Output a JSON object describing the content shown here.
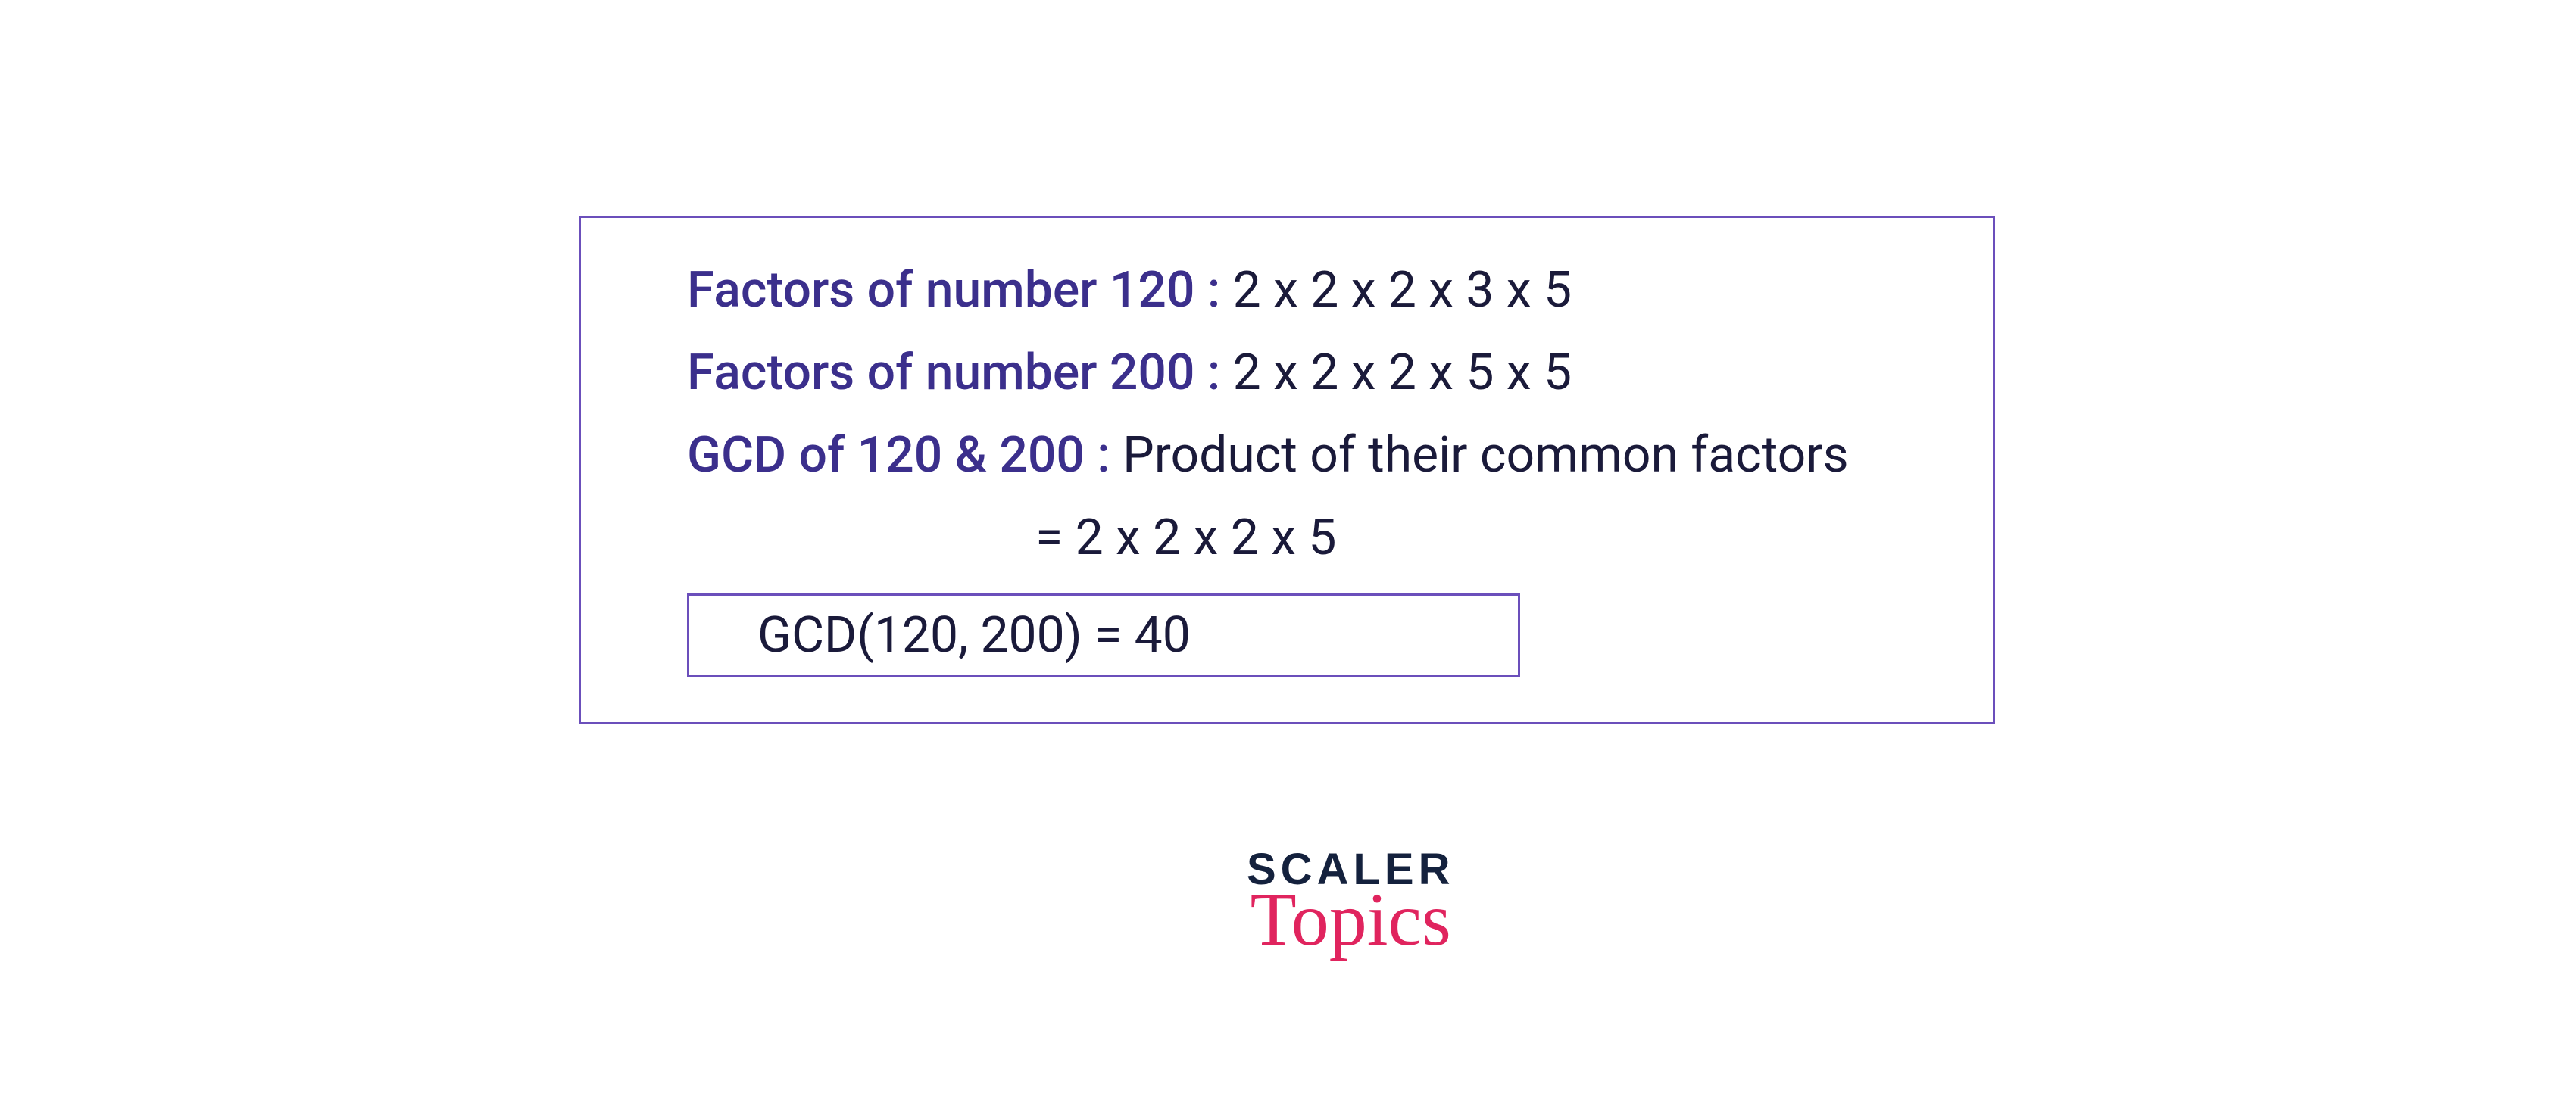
{
  "content": {
    "line1_label": "Factors of number 120 : ",
    "line1_value": "2 x 2 x 2 x 3 x 5",
    "line2_label": "Factors of number 200 : ",
    "line2_value": "2 x 2 x 2 x 5 x 5",
    "line3_label": "GCD of 120 & 200 : ",
    "line3_value": "Product of their common factors",
    "line4_value": "= 2 x 2 x 2 x 5",
    "result": "GCD(120, 200) = 40"
  },
  "logo": {
    "line1": "SCALER",
    "line2": "Topics"
  }
}
